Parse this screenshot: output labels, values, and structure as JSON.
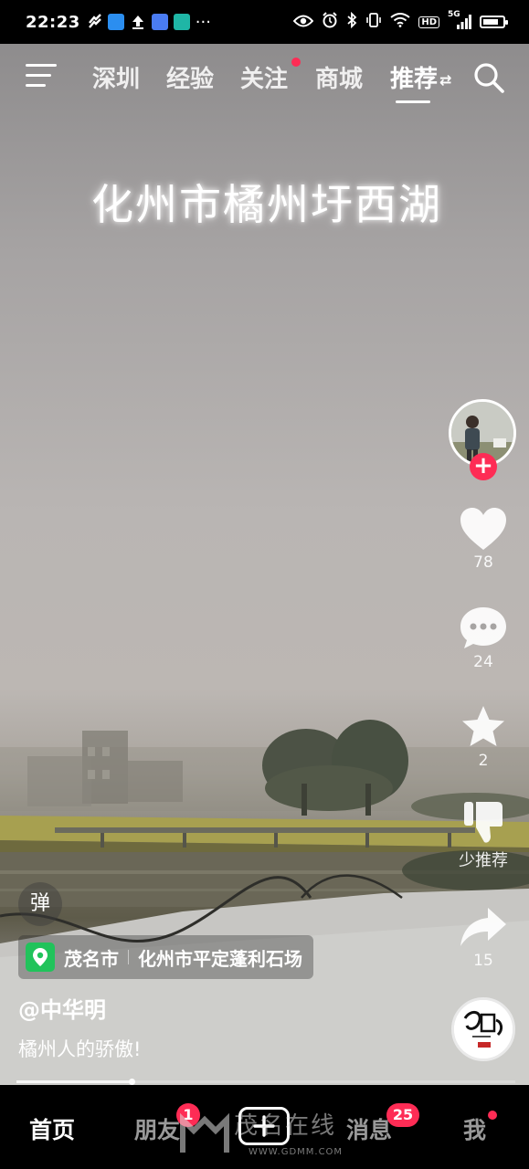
{
  "status_bar": {
    "time": "22:23",
    "more": "···",
    "network": "5G",
    "hd": "HD"
  },
  "top_nav": {
    "tabs": [
      "深圳",
      "经验",
      "关注",
      "商城",
      "推荐"
    ],
    "active_tab": "推荐",
    "swap_glyph": "⇄"
  },
  "video": {
    "overlay_caption": "化州市橘州圩西湖"
  },
  "actions": {
    "like_count": "78",
    "comment_count": "24",
    "favorite_count": "2",
    "less_recommend_label": "少推荐",
    "share_count": "15",
    "follow_symbol": "+"
  },
  "danmu_label": "弹",
  "location": {
    "city": "茂名市",
    "place": "化州市平定蓬利石场"
  },
  "author": "@中华明",
  "description": "橘州人的骄傲!",
  "playback": {
    "progress": 0.23
  },
  "bottom_nav": {
    "home": "首页",
    "friends": "朋友",
    "friends_badge": "1",
    "messages": "消息",
    "messages_badge": "25",
    "me": "我"
  },
  "watermark": {
    "title": "茂名在线",
    "url": "WWW.GDMM.COM"
  },
  "colors": {
    "accent": "#fe2c55",
    "location_pin": "#21c35b"
  }
}
